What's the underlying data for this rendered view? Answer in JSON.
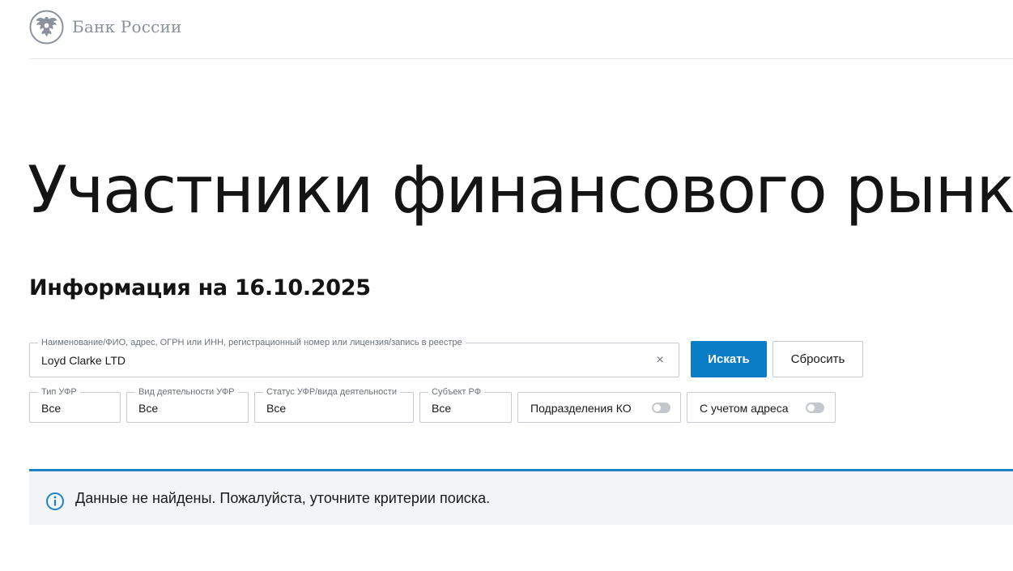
{
  "header": {
    "logo_text": "Банк России"
  },
  "page": {
    "title": "Участники финансового рынка",
    "subtitle": "Информация на 16.10.2025"
  },
  "search": {
    "legend": "Наименование/ФИО, адрес, ОГРН или ИНН, регистрационный номер или лицензия/запись в реестре",
    "value": "Loyd Clarke LTD",
    "clear_glyph": "×",
    "search_label": "Искать",
    "reset_label": "Сбросить"
  },
  "filters": [
    {
      "legend": "Тип УФР",
      "value": "Все"
    },
    {
      "legend": "Вид деятельности УФР",
      "value": "Все"
    },
    {
      "legend": "Статус УФР/вида деятельности",
      "value": "Все"
    },
    {
      "legend": "Субъект РФ",
      "value": "Все"
    }
  ],
  "toggles": [
    {
      "label": "Подразделения КО",
      "on": false
    },
    {
      "label": "С учетом адреса",
      "on": false
    }
  ],
  "notice": {
    "text": "Данные не найдены. Пожалуйста, уточните критерии поиска."
  },
  "colors": {
    "accent": "#0a7dc6",
    "notice_bar": "#1c83c6",
    "notice_bg": "#f3f4f5",
    "logo_gray": "#8a919d"
  },
  "icons": {
    "logo": "double-headed-eagle-emblem",
    "info": "info-circle-icon",
    "clear": "close-icon"
  }
}
